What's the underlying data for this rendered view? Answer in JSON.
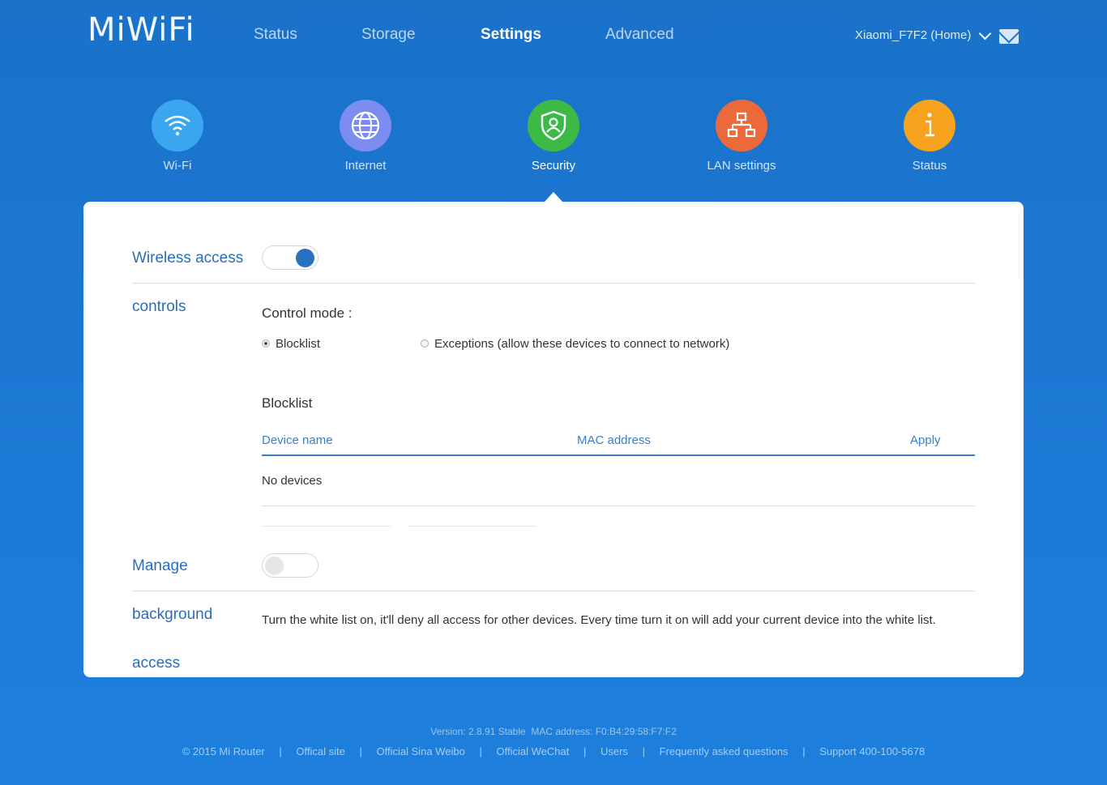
{
  "header": {
    "logo": "MiWiFi",
    "nav": [
      {
        "label": "Status"
      },
      {
        "label": "Storage"
      },
      {
        "label": "Settings",
        "active": true
      },
      {
        "label": "Advanced"
      }
    ],
    "router_name": "Xiaomi_F7F2 (Home)"
  },
  "categories": [
    {
      "label": "Wi-Fi",
      "icon": "wifi-icon",
      "color": "#3aa6f0"
    },
    {
      "label": "Internet",
      "icon": "globe-icon",
      "color": "#7c8cf0"
    },
    {
      "label": "Security",
      "icon": "shield-user-icon",
      "color": "#3dba46",
      "active": true
    },
    {
      "label": "LAN settings",
      "icon": "network-icon",
      "color": "#ec6a3a"
    },
    {
      "label": "Status",
      "icon": "info-icon",
      "color": "#f7a21d"
    }
  ],
  "panel": {
    "wireless_label": "Wireless access",
    "controls_label": "controls",
    "wireless_toggle_on": true,
    "control_mode_label": "Control mode :",
    "radio_blocklist": "Blocklist",
    "radio_exceptions": "Exceptions (allow these devices to connect to network)",
    "blocklist_title": "Blocklist",
    "table": {
      "columns": [
        "Device name",
        "MAC address",
        "Apply"
      ],
      "empty": "No devices"
    },
    "manage_label": "Manage",
    "background_label": "background",
    "access_label": "access",
    "manage_toggle_on": false,
    "white_list_note": "Turn the white list on, it'll deny all access for other devices. Every time turn it on will add your current device into the white list."
  },
  "footer": {
    "version_line": "Version: 2.8.91 Stable  MAC address: F0:B4:29:58:F7:F2",
    "links": [
      "© 2015 Mi Router",
      "Offical site",
      "Official Sina Weibo",
      "Official WeChat",
      "Users",
      "Frequently asked questions",
      "Support 400-100-5678"
    ],
    "separator": "|"
  },
  "colors": {
    "background": "#1c78d6",
    "accent_blue": "#2a6db8",
    "toggle_on": "#2870c0"
  }
}
